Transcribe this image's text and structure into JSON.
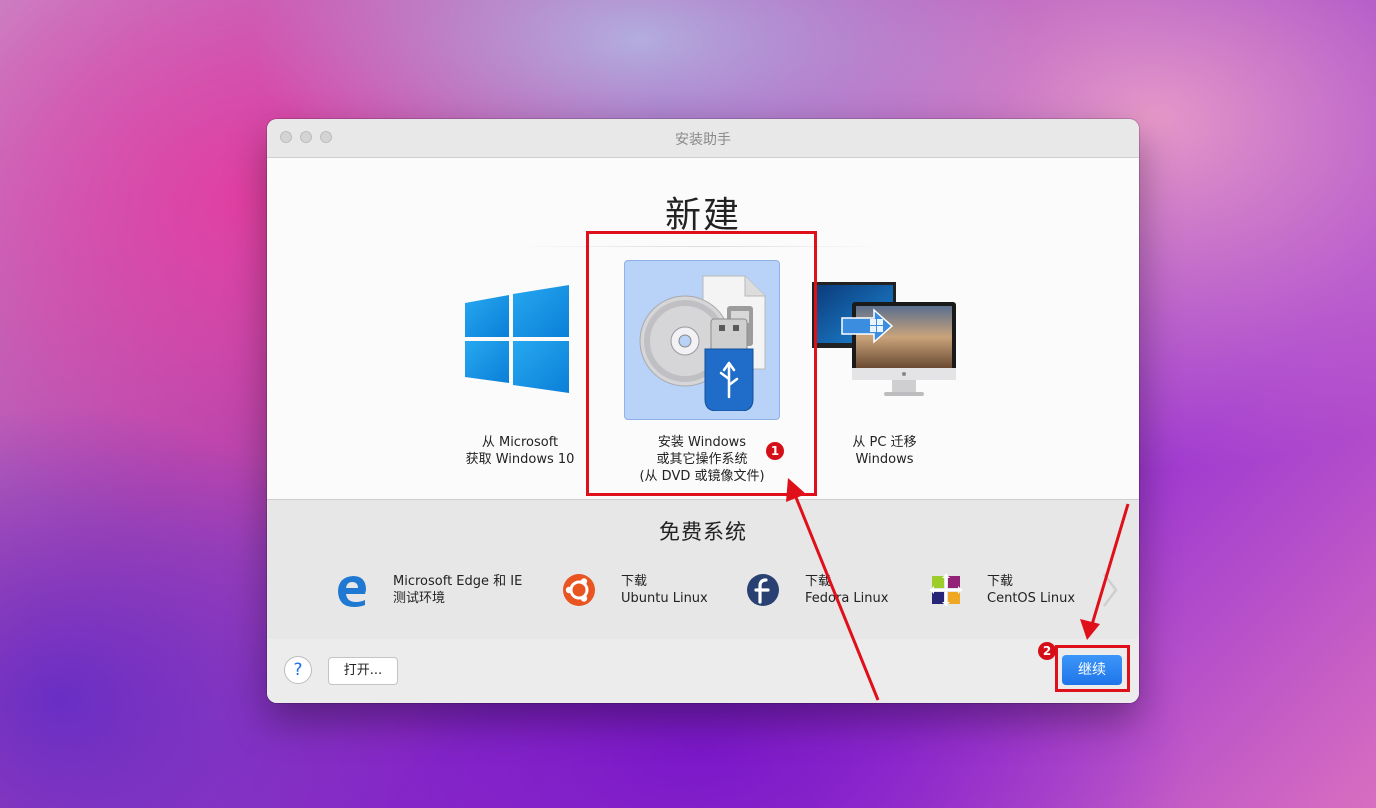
{
  "window": {
    "title": "安装助手"
  },
  "main": {
    "title": "新建",
    "options": [
      {
        "label_line1": "从 Microsoft",
        "label_line2": "获取 Windows 10",
        "icon": "windows-logo-icon"
      },
      {
        "label_line1": "安装 Windows",
        "label_line2": "或其它操作系统",
        "label_line3": "(从 DVD 或镜像文件)",
        "icon": "dvd-usb-image-icon",
        "selected": true
      },
      {
        "label_line1": "从 PC 迁移",
        "label_line2": "Windows",
        "icon": "pc-migration-icon"
      }
    ]
  },
  "free": {
    "title": "免费系统",
    "items": [
      {
        "line1": "Microsoft Edge 和 IE",
        "line2": "测试环境",
        "icon": "edge-icon"
      },
      {
        "line1": "下载",
        "line2": "Ubuntu Linux",
        "icon": "ubuntu-icon"
      },
      {
        "line1": "下载",
        "line2": "Fedora Linux",
        "icon": "fedora-icon"
      },
      {
        "line1": "下载",
        "line2": "CentOS Linux",
        "icon": "centos-icon"
      }
    ]
  },
  "footer": {
    "help_label": "?",
    "open_label": "打开...",
    "continue_label": "继续"
  },
  "annotations": {
    "badge1": "1",
    "badge2": "2",
    "color": "#e0101a"
  },
  "colors": {
    "accent": "#1e75ea",
    "selection": "#b8d2f8"
  }
}
